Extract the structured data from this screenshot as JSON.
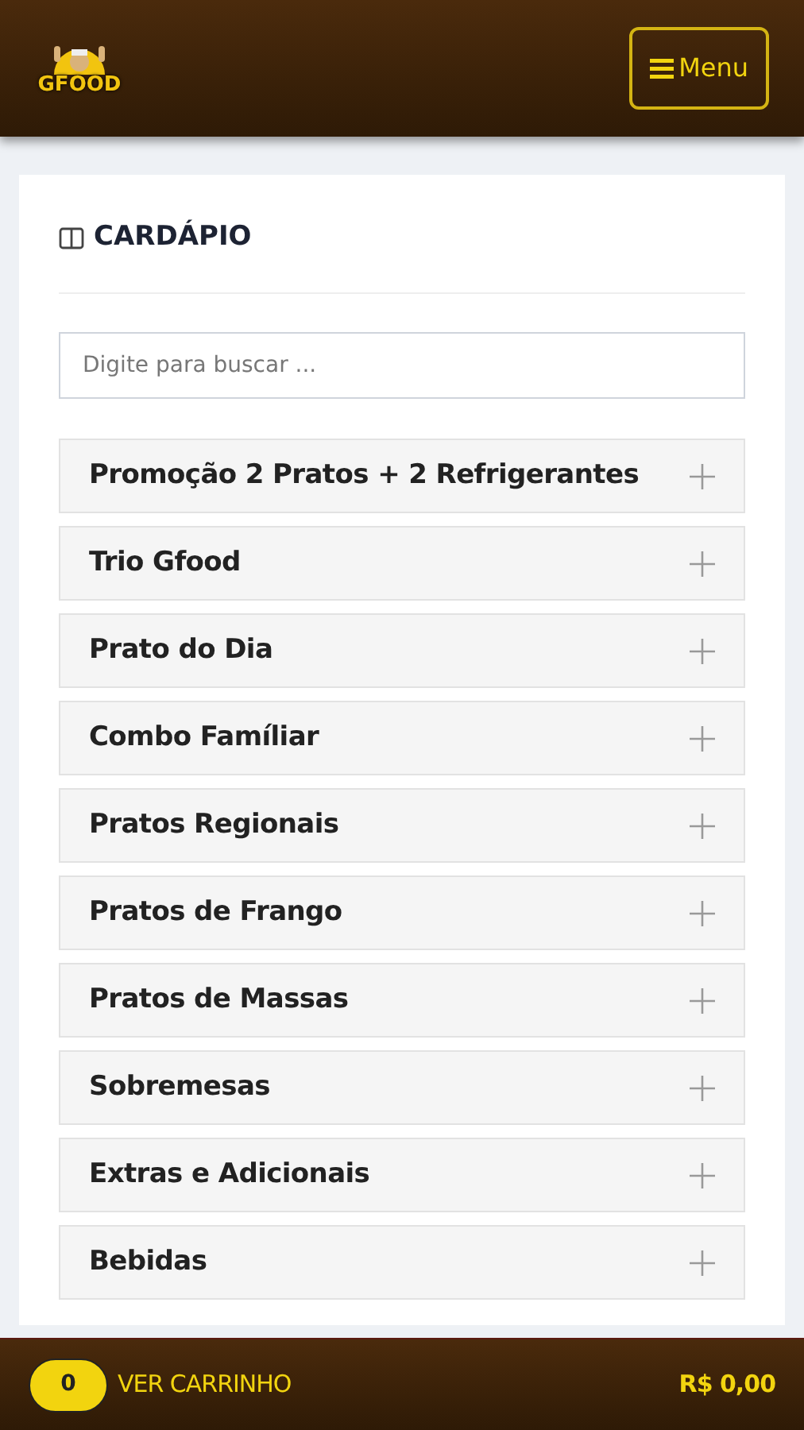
{
  "header": {
    "logo": "GFOOD",
    "menu_button": "Menu"
  },
  "menu_card": {
    "title": "CARDÁPIO",
    "search": {
      "placeholder": "Digite para buscar ..."
    },
    "categories": [
      {
        "label": "Promoção 2 Pratos + 2 Refrigerantes",
        "expanded": false
      },
      {
        "label": "Trio Gfood",
        "expanded": false
      },
      {
        "label": "Prato do Dia",
        "expanded": false
      },
      {
        "label": "Combo Famíliar",
        "expanded": false
      },
      {
        "label": "Pratos Regionais",
        "expanded": false
      },
      {
        "label": "Pratos de Frango",
        "expanded": false
      },
      {
        "label": "Pratos de Massas",
        "expanded": false
      },
      {
        "label": "Sobremesas",
        "expanded": false
      },
      {
        "label": "Extras e Adicionais",
        "expanded": false
      },
      {
        "label": "Bebidas",
        "expanded": false
      }
    ]
  },
  "cart_bar": {
    "count": "0",
    "label": "VER CARRINHO",
    "total": "R$ 0,00"
  }
}
